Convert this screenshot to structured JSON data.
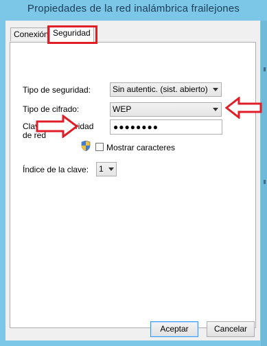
{
  "window": {
    "title": "Propiedades de la red inalámbrica frailejones"
  },
  "tabs": [
    {
      "label": "Conexión",
      "active": false
    },
    {
      "label": "Seguridad",
      "active": true
    }
  ],
  "security": {
    "type_label": "Tipo de seguridad:",
    "type_value": "Sin autentic. (sist. abierto)",
    "cipher_label": "Tipo de cifrado:",
    "cipher_value": "WEP",
    "key_label": "Clave de seguridad de red",
    "key_value": "●●●●●●●●",
    "show_chars_label": "Mostrar caracteres",
    "show_chars_checked": false,
    "key_index_label": "Índice de la clave:",
    "key_index_value": "1"
  },
  "buttons": {
    "accept": "Aceptar",
    "cancel": "Cancelar"
  },
  "colors": {
    "annotation": "#e11e28",
    "title_text": "#1b3c55",
    "frame": "#7cc7e8"
  }
}
